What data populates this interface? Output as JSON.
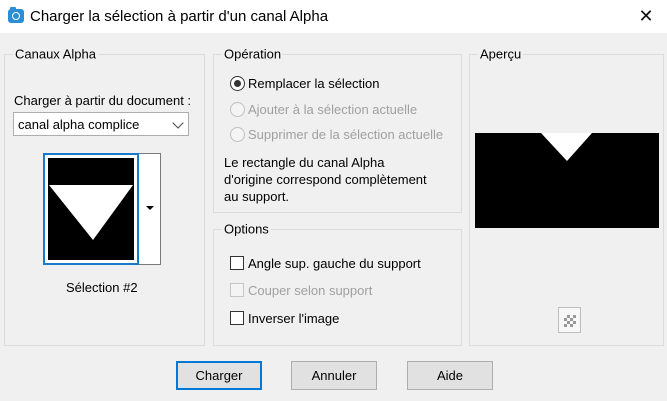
{
  "window": {
    "title": "Charger la sélection à partir d'un canal Alpha",
    "close_glyph": "✕"
  },
  "alpha_channels": {
    "group_title": "Canaux Alpha",
    "load_from_label": "Charger à partir du document :",
    "document_select_value": "canal alpha complice",
    "selection_name": "Sélection #2"
  },
  "operation": {
    "group_title": "Opération",
    "options": [
      {
        "label": "Remplacer la sélection",
        "checked": true,
        "enabled": true
      },
      {
        "label": "Ajouter à la sélection actuelle",
        "checked": false,
        "enabled": false
      },
      {
        "label": "Supprimer de la sélection actuelle",
        "checked": false,
        "enabled": false
      }
    ],
    "info_line1": "Le rectangle du canal Alpha",
    "info_line2": "d'origine correspond complètement",
    "info_line3": "au support."
  },
  "options": {
    "group_title": "Options",
    "checkboxes": [
      {
        "label": "Angle sup. gauche du support",
        "checked": false,
        "enabled": true
      },
      {
        "label": "Couper selon support",
        "checked": false,
        "enabled": false
      },
      {
        "label": "Inverser l'image",
        "checked": false,
        "enabled": true
      }
    ]
  },
  "preview": {
    "group_title": "Aperçu",
    "background_color": "#000000",
    "shape_color": "#ffffff"
  },
  "buttons": {
    "ok": "Charger",
    "cancel": "Annuler",
    "help": "Aide"
  },
  "colors": {
    "accent": "#0078d7",
    "dialog_bg": "#f0f0f0",
    "disabled_text": "#a0a0a0"
  }
}
